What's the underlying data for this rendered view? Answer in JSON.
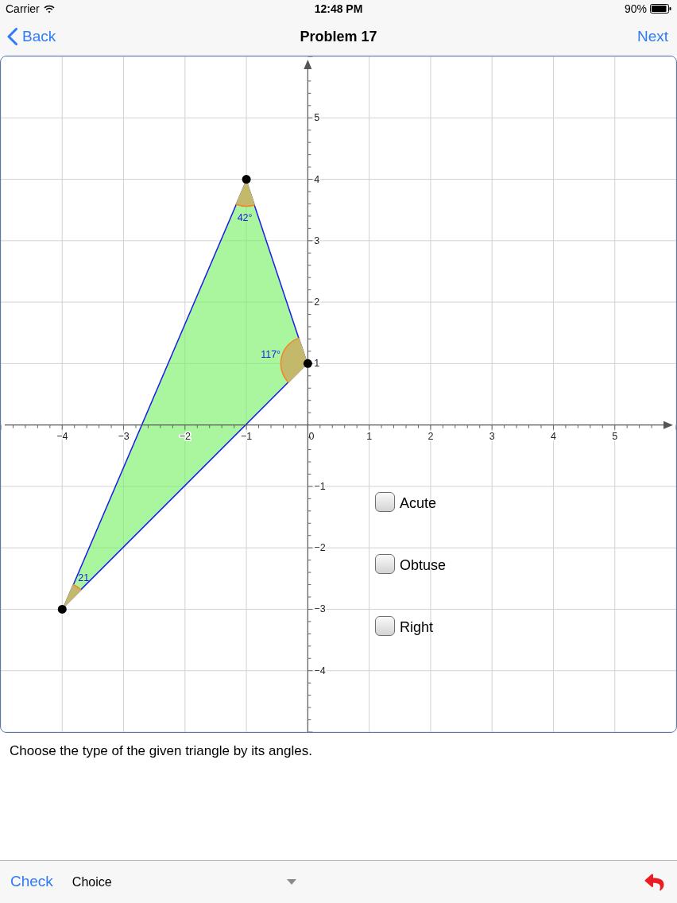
{
  "status_bar": {
    "carrier": "Carrier",
    "time": "12:48 PM",
    "battery": "90%"
  },
  "nav_bar": {
    "back": "Back",
    "title": "Problem 17",
    "next": "Next"
  },
  "graph": {
    "chart_data": {
      "type": "scatter",
      "x": [
        -1,
        0,
        -4
      ],
      "series": [
        {
          "color": "#000000",
          "values": [
            4,
            1,
            -3
          ]
        }
      ],
      "xlim": [
        -5,
        6
      ],
      "ylim": [
        -5,
        6
      ],
      "xticks": [
        {
          "value": -4,
          "label": "−4"
        },
        {
          "value": -3,
          "label": "−3"
        },
        {
          "value": -2,
          "label": "−2"
        },
        {
          "value": -1,
          "label": "−1"
        },
        0,
        1,
        2,
        3,
        4,
        5
      ],
      "yticks": [
        5,
        4,
        3,
        2,
        1,
        {
          "value": -1,
          "label": "−1"
        },
        {
          "value": -2,
          "label": "−2"
        },
        {
          "value": -3,
          "label": "−3"
        },
        {
          "value": -4,
          "label": "−4"
        }
      ],
      "grid": true,
      "annotations": [
        "42°",
        "117°",
        "21"
      ]
    },
    "choices": [
      {
        "label": "Acute",
        "checked": false
      },
      {
        "label": "Obtuse",
        "checked": false
      },
      {
        "label": "Right",
        "checked": false
      }
    ]
  },
  "prompt": "Choose the type of the given triangle by its angles.",
  "toolbar": {
    "check": "Check",
    "answer_type": "Choice"
  }
}
